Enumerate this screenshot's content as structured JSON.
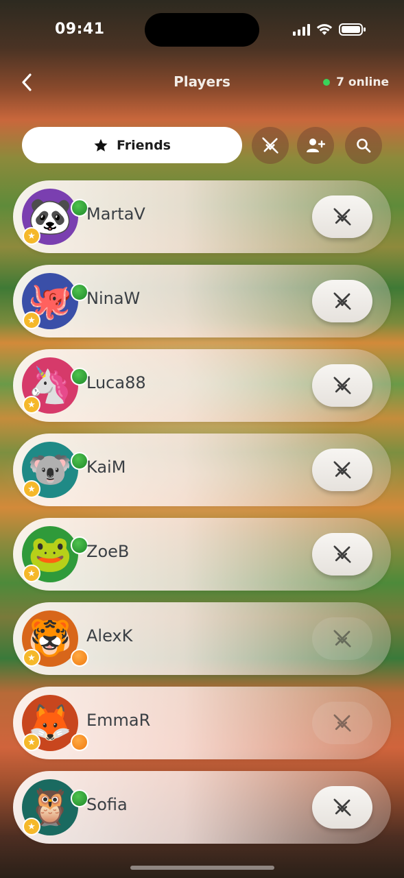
{
  "status_bar": {
    "time": "09:41"
  },
  "header": {
    "title": "Players",
    "online_count": "7 online"
  },
  "filter": {
    "active_label": "Friends"
  },
  "players": [
    {
      "name": "MartaV",
      "avatar": "🐼",
      "bg": "#7a3fb0",
      "status": "online",
      "challenge_enabled": true
    },
    {
      "name": "NinaW",
      "avatar": "🐙",
      "bg": "#3a4fa8",
      "status": "online",
      "challenge_enabled": true
    },
    {
      "name": "Luca88",
      "avatar": "🦄",
      "bg": "#d63a6a",
      "status": "online",
      "challenge_enabled": true
    },
    {
      "name": "KaiM",
      "avatar": "🐨",
      "bg": "#1f8a86",
      "status": "online",
      "challenge_enabled": true
    },
    {
      "name": "ZoeB",
      "avatar": "🐸",
      "bg": "#2f9a3a",
      "status": "online",
      "challenge_enabled": true
    },
    {
      "name": "AlexK",
      "avatar": "🐯",
      "bg": "#d8661a",
      "status": "busy",
      "challenge_enabled": false
    },
    {
      "name": "EmmaR",
      "avatar": "🦊",
      "bg": "#c8461e",
      "status": "busy",
      "challenge_enabled": false
    },
    {
      "name": "Sofia",
      "avatar": "🦉",
      "bg": "#1a6a60",
      "status": "online",
      "challenge_enabled": true
    }
  ],
  "colors": {
    "online": "#39d35a",
    "busy": "#f07a10",
    "star": "#f5b82a"
  }
}
